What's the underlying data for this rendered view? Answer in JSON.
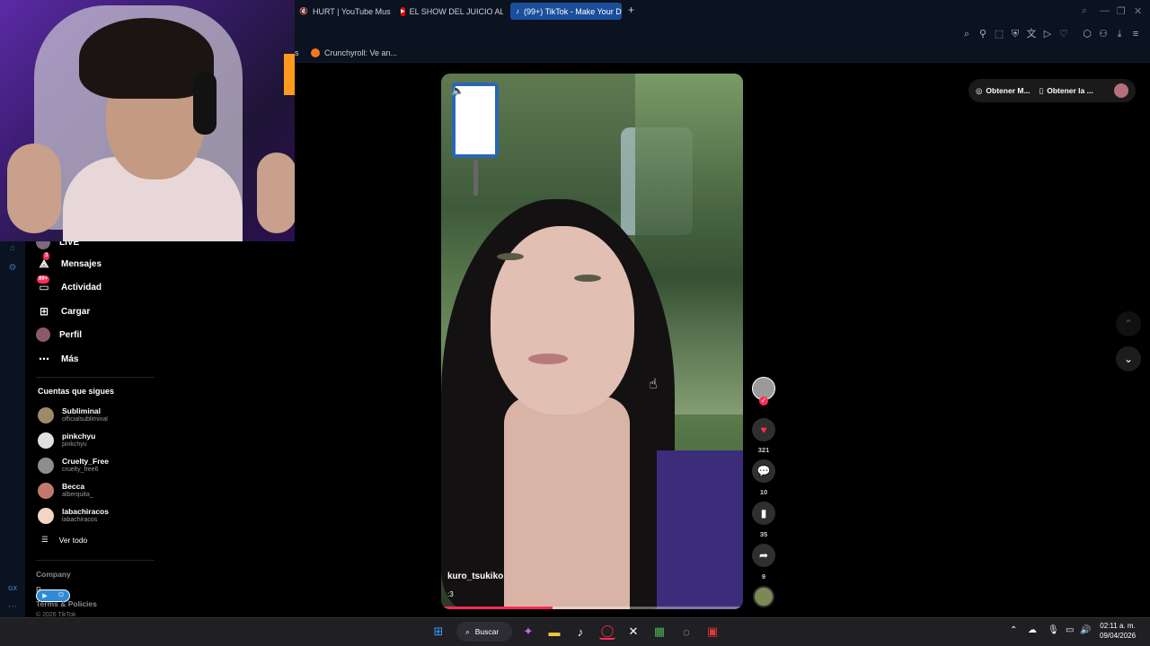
{
  "browser": {
    "tabs": [
      {
        "label": "HURT | YouTube Music",
        "icon": "muted-speaker-icon"
      },
      {
        "label": "EL SHOW DEL JUICIO ALF",
        "icon": "youtube-icon"
      },
      {
        "label": "(99+) TikTok - Make Your D",
        "icon": "tiktok-icon",
        "active": true
      }
    ],
    "bookmarks": [
      "s",
      "Crunchyroll: Ve an..."
    ]
  },
  "sidebar": {
    "items": [
      {
        "label": "LIVE"
      },
      {
        "label": "Mensajes",
        "badge": "3"
      },
      {
        "label": "Actividad",
        "badge": "99+"
      },
      {
        "label": "Cargar"
      },
      {
        "label": "Perfil"
      },
      {
        "label": "Más"
      }
    ],
    "following_title": "Cuentas que sigues",
    "following": [
      {
        "name": "Subliminal",
        "handle": "officialsubliminal"
      },
      {
        "name": "pinkchyu",
        "handle": "pinkchyu"
      },
      {
        "name": "Cruelty_Free",
        "handle": "cruelty_free6"
      },
      {
        "name": "Becca",
        "handle": "alberquita_"
      },
      {
        "name": "labachiracos",
        "handle": "labachiracos"
      }
    ],
    "see_all": "Ver todo",
    "footer": {
      "company": "Company",
      "program": "P...",
      "terms": "Terms & Policies",
      "copyright": "© 2026 TikTok"
    }
  },
  "video": {
    "username": "kuro_tsukiko",
    "description": ":3",
    "progress": 0.37
  },
  "actions": {
    "likes": "321",
    "comments": "10",
    "saves": "35",
    "shares": "9"
  },
  "top_right": {
    "btn1": "Obtener M...",
    "btn2": "Obtener la ..."
  },
  "taskbar": {
    "search": "Buscar",
    "time": "02:11 a. m.",
    "date": "09/04/2026"
  },
  "colors": {
    "accent": "#fe2c55",
    "browser_bg": "#0b1220",
    "active_tab": "#1b4e9b"
  }
}
